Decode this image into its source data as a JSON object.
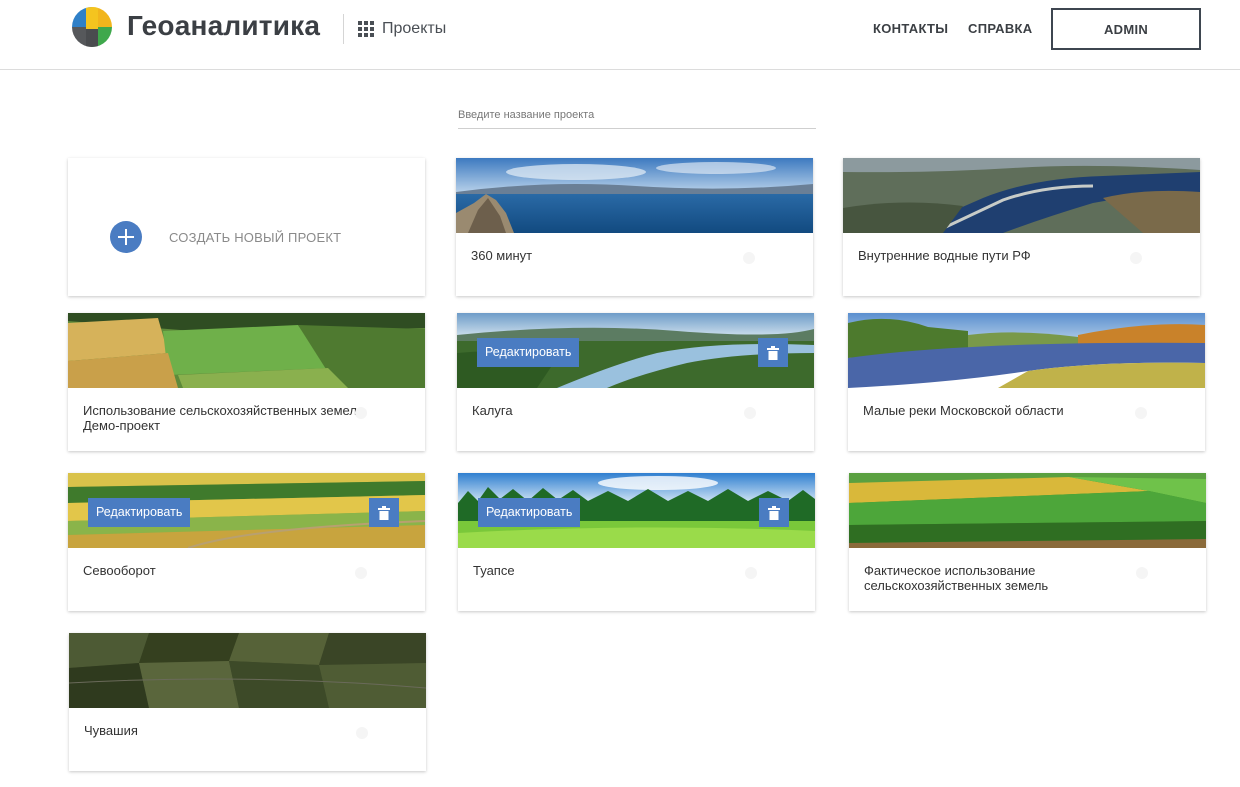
{
  "header": {
    "brand": "Геоаналитика",
    "projects_label": "Проекты",
    "nav": {
      "contacts": "КОНТАКТЫ",
      "help": "СПРАВКА"
    },
    "user_button": "ADMIN"
  },
  "search": {
    "placeholder": "Введите название проекта",
    "value": ""
  },
  "create_card": {
    "label": "СОЗДАТЬ НОВЫЙ ПРОЕКТ"
  },
  "actions": {
    "edit_label": "Редактировать"
  },
  "projects": [
    {
      "title": "360 минут"
    },
    {
      "title": "Внутренние водные пути РФ"
    },
    {
      "title": "Использование сельскохозяйственных земель. Демо-проект"
    },
    {
      "title": "Калуга"
    },
    {
      "title": "Малые реки Московской области"
    },
    {
      "title": "Севооборот"
    },
    {
      "title": "Туапсе"
    },
    {
      "title": "Фактическое использование сельскохозяйственных земель"
    },
    {
      "title": "Чувашия"
    }
  ],
  "colors": {
    "accent": "#4a7cc2",
    "text": "#333333",
    "header_text": "#3b3f44"
  },
  "icons": {
    "logo": "geoanalytics-logo-icon",
    "projects": "grid-icon",
    "create": "plus-icon",
    "delete": "trash-icon"
  }
}
